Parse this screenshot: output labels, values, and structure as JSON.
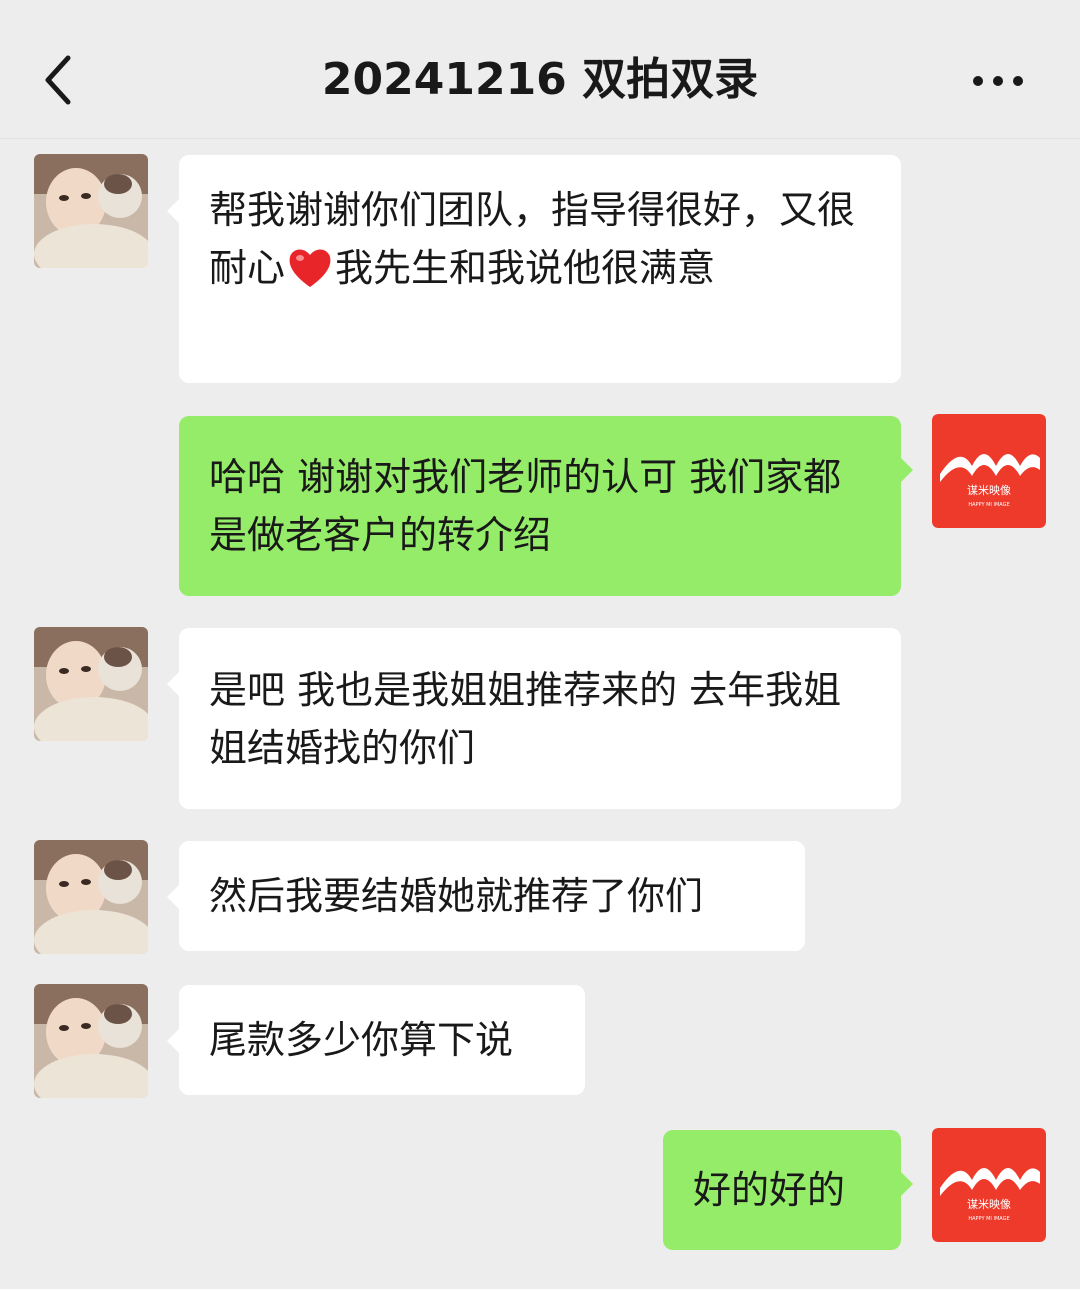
{
  "header": {
    "title": "20241216 双拍双录"
  },
  "brand": {
    "logo_text": "谋米映像",
    "logo_subtext": "HAPPY MI IMAGE",
    "logo_color": "#ee3a2b"
  },
  "colors": {
    "incoming_bubble": "#ffffff",
    "outgoing_bubble": "#95ec69",
    "background": "#ededed"
  },
  "messages": [
    {
      "direction": "incoming",
      "text_before_emoji": "帮我谢谢你们团队，指导得很好，又很耐心",
      "emoji": "red-heart",
      "text_after_emoji": "我先生和我说他很满意"
    },
    {
      "direction": "outgoing",
      "text": "哈哈 谢谢对我们老师的认可 我们家都是做老客户的转介绍"
    },
    {
      "direction": "incoming",
      "text": "是吧 我也是我姐姐推荐来的 去年我姐姐结婚找的你们"
    },
    {
      "direction": "incoming",
      "text": "然后我要结婚她就推荐了你们"
    },
    {
      "direction": "incoming",
      "text": "尾款多少你算下说"
    },
    {
      "direction": "outgoing",
      "text": "好的好的"
    }
  ]
}
